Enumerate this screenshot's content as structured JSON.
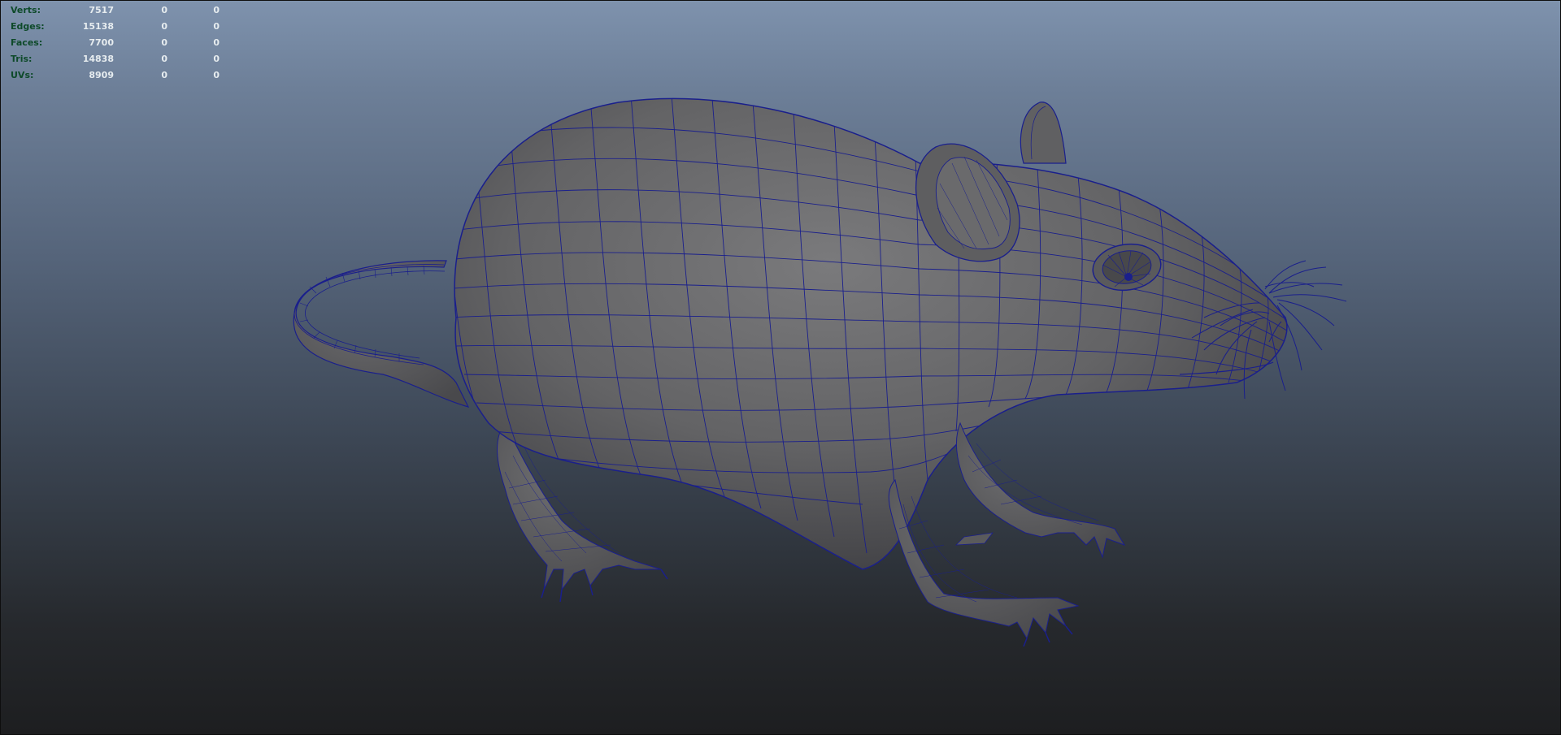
{
  "viewport": {
    "name": "3D perspective viewport",
    "subject": "rat-mesh",
    "background_top": "#7e92ad",
    "background_bottom": "#1d1e20",
    "mesh_color": "#6a6a6c",
    "wire_color": "#1a1f8c"
  },
  "hud": {
    "rows": [
      {
        "label": "Verts:",
        "values": [
          "7517",
          "0",
          "0"
        ]
      },
      {
        "label": "Edges:",
        "values": [
          "15138",
          "0",
          "0"
        ]
      },
      {
        "label": "Faces:",
        "values": [
          "7700",
          "0",
          "0"
        ]
      },
      {
        "label": "Tris:",
        "values": [
          "14838",
          "0",
          "0"
        ]
      },
      {
        "label": "UVs:",
        "values": [
          "8909",
          "0",
          "0"
        ]
      }
    ]
  }
}
